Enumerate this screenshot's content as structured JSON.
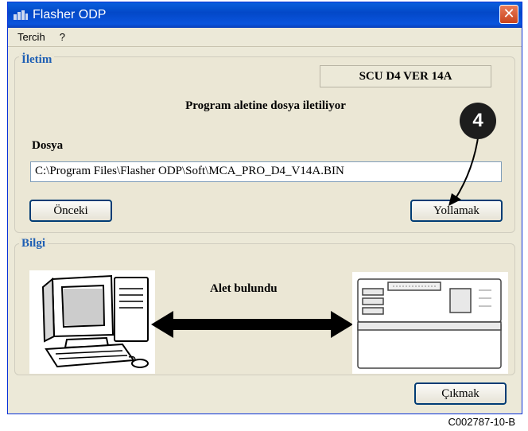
{
  "window": {
    "title": "Flasher ODP",
    "close_glyph": "✕"
  },
  "menu": {
    "items": [
      "Tercih",
      "?"
    ]
  },
  "transmission": {
    "group_label": "İletim",
    "version": "SCU D4 VER  14A",
    "status": "Program aletine dosya iletiliyor",
    "file_label": "Dosya",
    "file_path": "C:\\Program Files\\Flasher ODP\\Soft\\MCA_PRO_D4_V14A.BIN",
    "previous_button": "Önceki",
    "send_button": "Yollamak"
  },
  "info": {
    "group_label": "Bilgi",
    "device_status": "Alet bulundu",
    "icons": [
      "computer-icon",
      "double-arrow-icon",
      "controller-device-icon"
    ]
  },
  "exit_button": "Çıkmak",
  "annotation": {
    "step": "4"
  },
  "caption": "C002787-10-B"
}
